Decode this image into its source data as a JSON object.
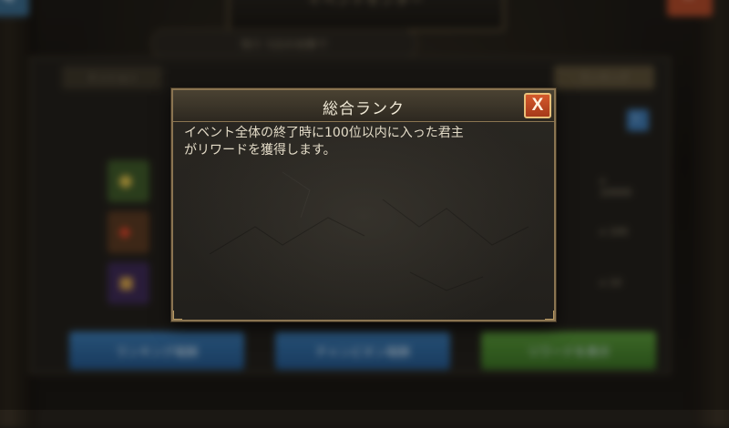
{
  "background": {
    "header_title": "イベントセンター",
    "subheader": "残り 5日の攻撃で",
    "tabs": [
      "ミッション",
      "ランキング"
    ],
    "reward_amounts": [
      "x 10000",
      "x 100",
      "x 10"
    ],
    "buttons": [
      "ランキング報酬",
      "チャンピオン報酬",
      "リワードを表示"
    ],
    "back_icon": "back-arrow-icon",
    "close_icon": "close-icon",
    "info_icon": "info-icon"
  },
  "dialog": {
    "title": "総合ランク",
    "close_label": "X",
    "description_line1": "イベント全体の終了時に100位以内に入った君主",
    "description_line2": "がリワードを獲得します。"
  },
  "colors": {
    "dialog_border": "#8a7451",
    "close_button": "#c14a22",
    "text": "#e4dcc8"
  }
}
